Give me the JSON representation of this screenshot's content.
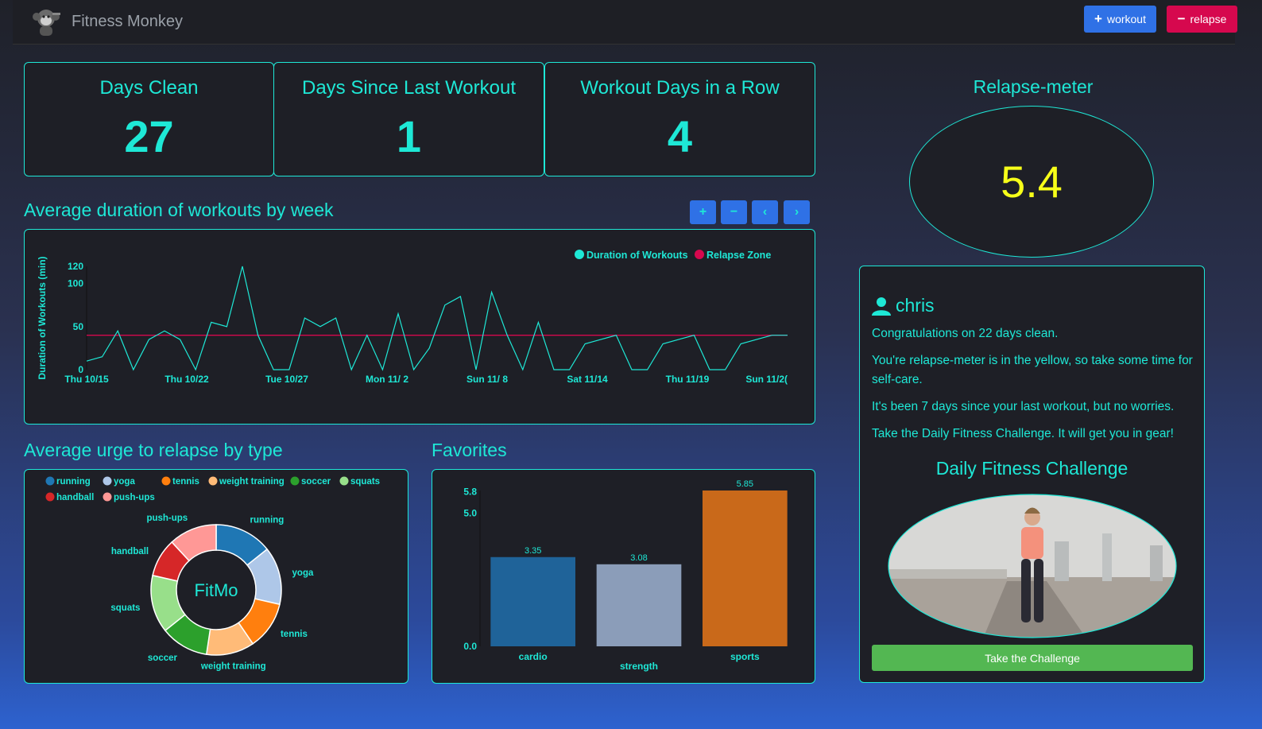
{
  "app": {
    "title": "Fitness Monkey"
  },
  "nav": {
    "workout_label": "workout",
    "relapse_label": "relapse"
  },
  "stats": [
    {
      "title": "Days Clean",
      "value": "27"
    },
    {
      "title": "Days Since Last Workout",
      "value": "1"
    },
    {
      "title": "Workout Days in a Row",
      "value": "4"
    }
  ],
  "relapse_meter": {
    "title": "Relapse-meter",
    "value": "5.4",
    "value_color": "#f7ff19"
  },
  "duration_chart": {
    "section_title": "Average duration of workouts by week",
    "controls": [
      "plus-icon",
      "minus-icon",
      "chevron-left-icon",
      "chevron-right-icon"
    ]
  },
  "urge_chart": {
    "section_title": "Average urge to relapse by type",
    "center_label": "FitMo"
  },
  "favorites_chart": {
    "section_title": "Favorites"
  },
  "user": {
    "name": "chris",
    "messages": [
      "Congratulations on 22 days clean.",
      "You're relapse-meter is in the yellow, so take some time for self-care.",
      "It's been 7 days since your last workout, but no worries.",
      "Take the Daily Fitness Challenge. It will get you in gear!"
    ],
    "challenge_title": "Daily Fitness Challenge",
    "challenge_button": "Take the Challenge"
  },
  "colors": {
    "accent": "#1ee8d6",
    "relapse_zone": "#d6084e",
    "workout_button": "#2f71e6",
    "relapse_button": "#d6084e",
    "challenge_button": "#53b752"
  },
  "chart_data": [
    {
      "type": "line",
      "ylabel": "Duration of Workouts (min)",
      "xlabel": "",
      "x_tick_labels": [
        "Thu 10/15",
        "Thu 10/22",
        "Tue 10/27",
        "Mon 11/ 2",
        "Sun 11/ 8",
        "Sat 11/14",
        "Thu 11/19",
        "Sun 11/2("
      ],
      "y_ticks": [
        0,
        50,
        100,
        120
      ],
      "ylim": [
        0,
        120
      ],
      "legend": [
        "Duration of Workouts",
        "Relapse Zone"
      ],
      "legend_position": "top-right",
      "series": [
        {
          "name": "Duration of Workouts",
          "color": "#1ee8d6",
          "values": [
            10,
            15,
            45,
            0,
            35,
            45,
            35,
            0,
            55,
            50,
            120,
            40,
            0,
            0,
            60,
            50,
            60,
            0,
            40,
            0,
            65,
            0,
            25,
            75,
            85,
            0,
            90,
            40,
            0,
            55,
            0,
            0,
            30,
            35,
            40,
            0,
            0,
            30,
            35,
            40,
            0,
            0,
            30,
            35,
            40,
            40
          ]
        },
        {
          "name": "Relapse Zone",
          "color": "#d6084e",
          "values": [
            40,
            40
          ]
        }
      ]
    },
    {
      "type": "pie",
      "center_label": "FitMo",
      "legend_position": "top",
      "categories": [
        "running",
        "yoga",
        "tennis",
        "weight training",
        "soccer",
        "squats",
        "handball",
        "push-ups"
      ],
      "values": [
        6,
        6,
        5,
        5,
        5,
        6,
        4,
        5
      ],
      "colors": [
        "#1f77b4",
        "#aec7e8",
        "#ff7f0e",
        "#ffbb78",
        "#2ca02c",
        "#98df8a",
        "#d62728",
        "#ff9896"
      ]
    },
    {
      "type": "bar",
      "categories": [
        "cardio",
        "strength",
        "sports"
      ],
      "values": [
        3.35,
        3.08,
        5.85
      ],
      "value_labels": [
        "3.35",
        "3.08",
        "5.85"
      ],
      "colors": [
        "#1f6399",
        "#8b9db9",
        "#c9691a"
      ],
      "y_ticks": [
        "0.0",
        "5.0",
        "5.8"
      ],
      "ylim": [
        0,
        5.85
      ]
    }
  ]
}
